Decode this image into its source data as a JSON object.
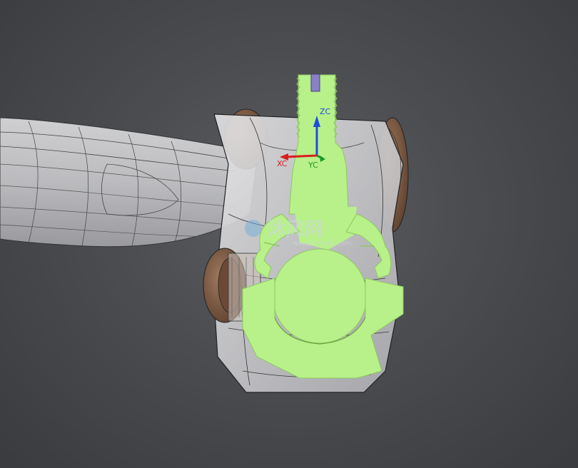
{
  "viewport": {
    "background_color": "#4a4c50",
    "section_color": "#b8f08a",
    "wireframe_color": "#222222",
    "bearing_color": "#7a5a45"
  },
  "axes": {
    "z_label": "ZC",
    "x_label": "XC",
    "y_label": "YC",
    "z_color": "#1e4ed8",
    "x_color": "#d81e1e",
    "y_color": "#1a9a2a"
  },
  "watermark": {
    "title": "沐风网",
    "url": "www.mfcad.com"
  }
}
